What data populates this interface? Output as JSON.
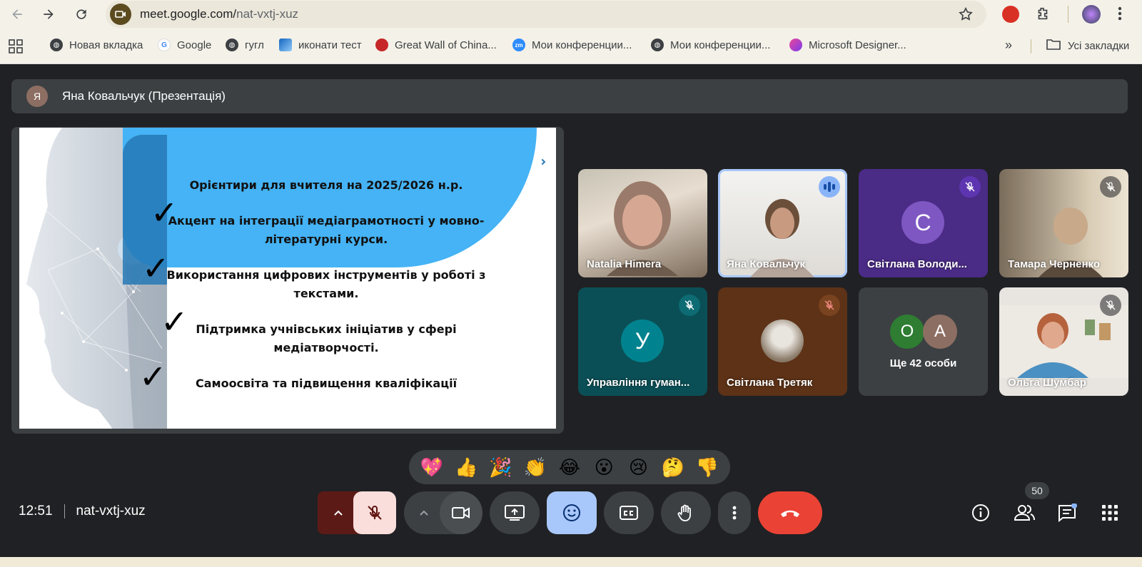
{
  "browser": {
    "url_host": "meet.google.com/",
    "url_path": "nat-vxtj-xuz"
  },
  "bookmarks": [
    {
      "label": "Новая вкладка",
      "icon": "globe-icon"
    },
    {
      "label": "Google",
      "icon": "google-icon"
    },
    {
      "label": "гугл",
      "icon": "globe-icon"
    },
    {
      "label": "иконати тест",
      "icon": "stripes-icon"
    },
    {
      "label": "Great Wall of China...",
      "icon": "lantern-icon"
    },
    {
      "label": "Мои конференции...",
      "icon": "zoom-icon"
    },
    {
      "label": "Мои конференции...",
      "icon": "globe-icon"
    },
    {
      "label": "Microsoft Designer...",
      "icon": "designer-icon"
    }
  ],
  "bookmarks_all": "Усі закладки",
  "presenter": {
    "initial": "Я",
    "label": "Яна Ковальчук (Презентація)"
  },
  "slide": {
    "title": "Орієнтири для вчителя на 2025/2026 н.р.",
    "items": [
      "Акцент на інтеграції медіаграмотності у мовно-літературні курси.",
      "Використання цифрових інструментів у роботі з текстами.",
      "Підтримка учнівських ініціатив у сфері медіатворчості.",
      "Самоосвіта та підвищення кваліфікації"
    ],
    "check": "✓"
  },
  "participants": [
    {
      "name": "Natalia Himera",
      "muted": false
    },
    {
      "name": "Яна Ковальчук",
      "speaking": true
    },
    {
      "name": "Світлана Володи...",
      "initial": "С",
      "muted": true,
      "color": "#7e57c2"
    },
    {
      "name": "Тамара Черненко",
      "muted": true
    },
    {
      "name": "Управління гуман...",
      "initial": "У",
      "muted": true,
      "color": "#00838f"
    },
    {
      "name": "Світлана Третяк",
      "muted": true
    },
    {
      "name": "Ще 42 особи",
      "initials": [
        "О",
        "А"
      ]
    },
    {
      "name": "Ольга Шумбар",
      "muted": true
    }
  ],
  "reactions": [
    "💖",
    "👍",
    "🎉",
    "👏",
    "😂",
    "😮",
    "😢",
    "🤔",
    "👎"
  ],
  "meeting": {
    "time": "12:51",
    "code": "nat-vxtj-xuz",
    "people_count": "50"
  },
  "colors": {
    "background": "#202124",
    "end_call": "#ea4335",
    "reactions_active": "#a8c7fa",
    "mic_off": "#f9dedc"
  }
}
